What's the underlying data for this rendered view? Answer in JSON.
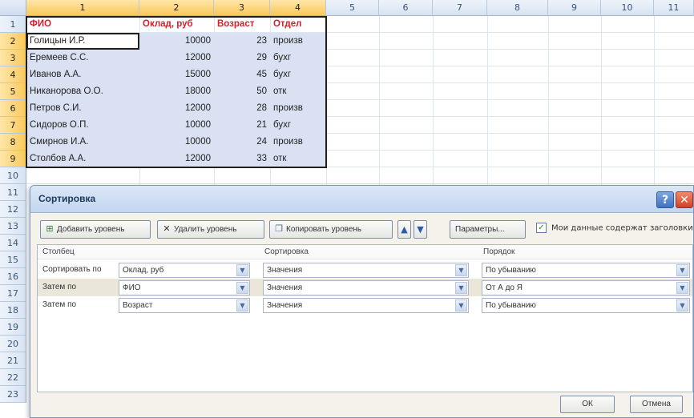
{
  "sheet": {
    "column_headers": [
      "1",
      "2",
      "3",
      "4",
      "5",
      "6",
      "7",
      "8",
      "9",
      "10",
      "11"
    ],
    "row_headers": [
      "1",
      "2",
      "3",
      "4",
      "5",
      "6",
      "7",
      "8",
      "9",
      "10",
      "11",
      "12",
      "13",
      "14",
      "15",
      "16",
      "17",
      "18",
      "19",
      "20",
      "21",
      "22",
      "23"
    ],
    "table_header": [
      "ФИО",
      "Оклад, руб",
      "Возраст",
      "Отдел"
    ],
    "rows": [
      [
        "Голицын И.Р.",
        "10000",
        "23",
        "произв"
      ],
      [
        "Еремеев С.С.",
        "12000",
        "29",
        "бухг"
      ],
      [
        "Иванов А.А.",
        "15000",
        "45",
        "бухг"
      ],
      [
        "Никанорова О.О.",
        "18000",
        "50",
        "отк"
      ],
      [
        "Петров С.И.",
        "12000",
        "28",
        "произв"
      ],
      [
        "Сидоров О.П.",
        "10000",
        "21",
        "бухг"
      ],
      [
        "Смирнов И.А.",
        "10000",
        "24",
        "произв"
      ],
      [
        "Столбов А.А.",
        "12000",
        "33",
        "отк"
      ]
    ]
  },
  "dialog": {
    "title": "Сортировка",
    "help_symbol": "?",
    "close_symbol": "✕",
    "toolbar": {
      "add_level": "Добавить уровень",
      "delete_level": "Удалить уровень",
      "copy_level": "Копировать уровень",
      "move_up": "▲",
      "move_down": "▼",
      "options": "Параметры...",
      "has_headers_label": "Мои данные содержат заголовки",
      "has_headers_checked": true
    },
    "columns": {
      "column": "Столбец",
      "sort_on": "Сортировка",
      "order": "Порядок"
    },
    "levels": [
      {
        "label": "Сортировать по",
        "column": "Оклад, руб",
        "sort_on": "Значения",
        "order": "По убыванию"
      },
      {
        "label": "Затем по",
        "column": "ФИО",
        "sort_on": "Значения",
        "order": "От А до Я"
      },
      {
        "label": "Затем по",
        "column": "Возраст",
        "sort_on": "Значения",
        "order": "По убыванию"
      }
    ],
    "ok": "ОК",
    "cancel": "Отмена"
  }
}
